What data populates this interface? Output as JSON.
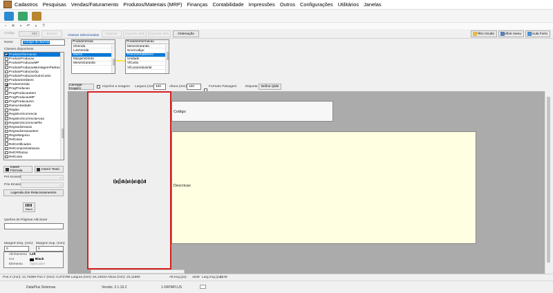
{
  "menu": [
    "Cadastros",
    "Pesquisas",
    "Vendas/Faturamento",
    "Produtos/Materiais (MRP)",
    "Finanças",
    "Contabilidade",
    "Impressões",
    "Outros",
    "Configurações",
    "Utilitários",
    "Janelas"
  ],
  "toolbar": {
    "codigo_label": "Codigo",
    "codigo_value": "550",
    "buscar_label": "Buscar",
    "nome_label": "Nome",
    "nome_value": "Código de Barras",
    "classes_selecionadas": "Classes Selecionadas",
    "imprimir": "Imprimir",
    "exportar_xml": "Exportar XML",
    "importar_xml": "Importar XML",
    "ordenacao": "Ordenação",
    "filtro_oculto": "Filtro Oculto",
    "definir_menu": "Definir menu",
    "vincula_form": "Vincula Form"
  },
  "left": {
    "classes_disponiveis": "Classes disponíveis",
    "classes": [
      {
        "label": "ProdutoInformacao",
        "checked": true,
        "selected": true
      },
      {
        "label": "ProdutoProducao",
        "checked": false
      },
      {
        "label": "ProdutoProducaoMP",
        "checked": false
      },
      {
        "label": "ProdutoProducaoMontagemPadrao",
        "checked": false
      },
      {
        "label": "ProdutoProducaoOp",
        "checked": false
      },
      {
        "label": "ProdutoProducaoOutroCusto",
        "checked": false
      },
      {
        "label": "ProdutoSimilares",
        "checked": false
      },
      {
        "label": "ProdutoVenda",
        "checked": true
      },
      {
        "label": "ProgProducao",
        "checked": false
      },
      {
        "label": "ProgProducaoItem",
        "checked": false
      },
      {
        "label": "ProgProducaoMP",
        "checked": false
      },
      {
        "label": "ProgProducaoSA",
        "checked": false
      },
      {
        "label": "RamoAtividade",
        "checked": false
      },
      {
        "label": "Regiao",
        "checked": false
      },
      {
        "label": "RegistroOcorrencia",
        "checked": false
      },
      {
        "label": "RegistroOcorrenciaAcao",
        "checked": false
      },
      {
        "label": "RegistroOcorrenciaFile",
        "checked": false
      },
      {
        "label": "RegraLiberacao",
        "checked": false
      },
      {
        "label": "RegraLiberacaoItem",
        "checked": false
      },
      {
        "label": "RegraNegocio",
        "checked": false
      },
      {
        "label": "RelCaixa",
        "checked": false
      },
      {
        "label": "RelCertificados",
        "checked": false
      },
      {
        "label": "RelComprasVariacao",
        "checked": false
      },
      {
        "label": "RelCRRazao",
        "checked": false
      },
      {
        "label": "RelCusto",
        "checked": false
      }
    ],
    "inserir_formula": "Inserir Fórmula",
    "inserir_texto": "Inserir Texto",
    "pre_emissao": "Pré Emissão",
    "pos_emissao": "Pós Emissão",
    "legenda": "Legenda dos Relacionamentos",
    "barra": "Barra",
    "quebra_label": "Quebra de Páginas Adicional",
    "margem_esq_label": "Margem Esq. (mm):",
    "margem_esq_value": "0",
    "margem_sup_label": "Margem Sup. (mm):",
    "margem_sup_value": "0",
    "props": [
      {
        "name": "Alinhamento",
        "value": "Left"
      },
      {
        "name": "Cor",
        "value": "Black"
      },
      {
        "name": "Elemento",
        "value": "Op5rLabel"
      }
    ]
  },
  "lists": {
    "produto_venda_title": "ProdutoVenda",
    "produto_venda": [
      "IdVenda",
      "LoteVenda",
      "Marca",
      "MargemDireta",
      "MesesGarantia"
    ],
    "produto_venda_selected": 2,
    "produto_info_title": "ProdutoInformacao",
    "produto_info": [
      "MesesGarantia",
      "NcmCodigo",
      "PrecoVendaDireto",
      "Unidade",
      "VlCusto",
      "VlCustoIndustrial"
    ],
    "produto_info_selected": 2
  },
  "options": {
    "carregar_imagem": "Carregar Imagem",
    "imprimir_imagem": "Imprimir a Imagem",
    "largura_label": "Largura (mm):",
    "largura_value": "100",
    "altura_label": "Altura (mm):",
    "altura_value": "100",
    "formato_paisagem": "Formato Paisagem",
    "etiqueta": "Etiqueta",
    "define_qtde": "Define Qtde"
  },
  "canvas": {
    "codigo_field": "Codigo",
    "descricao_field": "Descricao",
    "barcode_label": "Barcode"
  },
  "status": {
    "pos": "Pos.X (mm): 21,78398 Pos.Y (mm): 0,373786 Largura (mm): 64,13834 Altura (mm): 23,11893",
    "alt_img_label": "Alt.Img.(px):",
    "alt_img_value": "1648",
    "larg_img_label": "Larg.Img.(px):",
    "larg_img_value": "1648"
  },
  "footer": {
    "company": "DataPlus Sistemas",
    "version": "Versão: 2.1.16.2",
    "user": "1-DATAPLUS"
  },
  "colors": {
    "accent": "#0078d7",
    "highlight_red": "#d42020",
    "field_yellow": "#ffffe1",
    "connector_yellow": "#f5e642"
  }
}
